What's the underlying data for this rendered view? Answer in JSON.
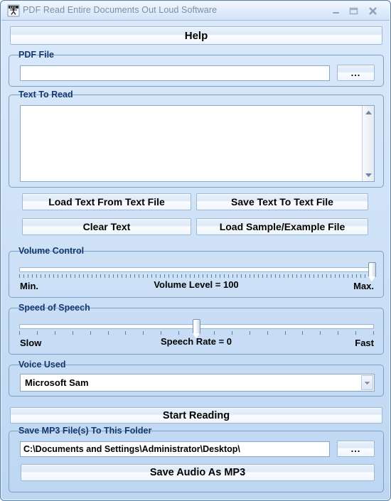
{
  "window": {
    "title": "PDF Read Entire Documents Out Loud Software",
    "icon": "app-reader-icon",
    "controls": {
      "minimize": "minimize-icon",
      "maximize": "maximize-icon",
      "close": "close-icon"
    }
  },
  "colors": {
    "window_background": "#cfe2f7",
    "group_border": "#7ba0c6",
    "group_title_text": "#14386e",
    "title_text": "#7b8fa6",
    "button_border": "#9fb8d4",
    "field_border": "#8ba6c4",
    "tick_mark": "#5f7fa4"
  },
  "toolbar": {
    "help_label": "Help"
  },
  "pdf_file": {
    "group_title": "PDF File",
    "input_value": "",
    "input_placeholder": "",
    "browse_label": "..."
  },
  "text_to_read": {
    "group_title": "Text To Read",
    "textarea_value": "",
    "textarea_placeholder": "",
    "scroll_up_icon": "scroll-up-arrow-icon",
    "scroll_down_icon": "scroll-down-arrow-icon",
    "buttons": {
      "load_text": "Load Text From Text File",
      "save_text": "Save Text To Text File",
      "clear_text": "Clear Text",
      "load_sample": "Load Sample/Example File"
    }
  },
  "volume_control": {
    "group_title": "Volume Control",
    "min_label": "Min.",
    "max_label": "Max.",
    "value_label": "Volume Level = 100",
    "value": 100,
    "min": 0,
    "max": 100,
    "tick_count": 84
  },
  "speed_of_speech": {
    "group_title": "Speed of Speech",
    "min_label": "Slow",
    "max_label": "Fast",
    "value_label": "Speech Rate = 0",
    "value": 0,
    "min": -10,
    "max": 10,
    "tick_count": 21
  },
  "voice_used": {
    "group_title": "Voice Used",
    "selected": "Microsoft Sam",
    "dropdown_icon": "chevron-down-icon"
  },
  "start_reading": {
    "label": "Start Reading"
  },
  "save_mp3": {
    "group_title": "Save MP3 File(s) To This Folder",
    "folder_value": "C:\\Documents and Settings\\Administrator\\Desktop\\",
    "folder_placeholder": "",
    "browse_label": "...",
    "save_label": "Save Audio As MP3"
  }
}
